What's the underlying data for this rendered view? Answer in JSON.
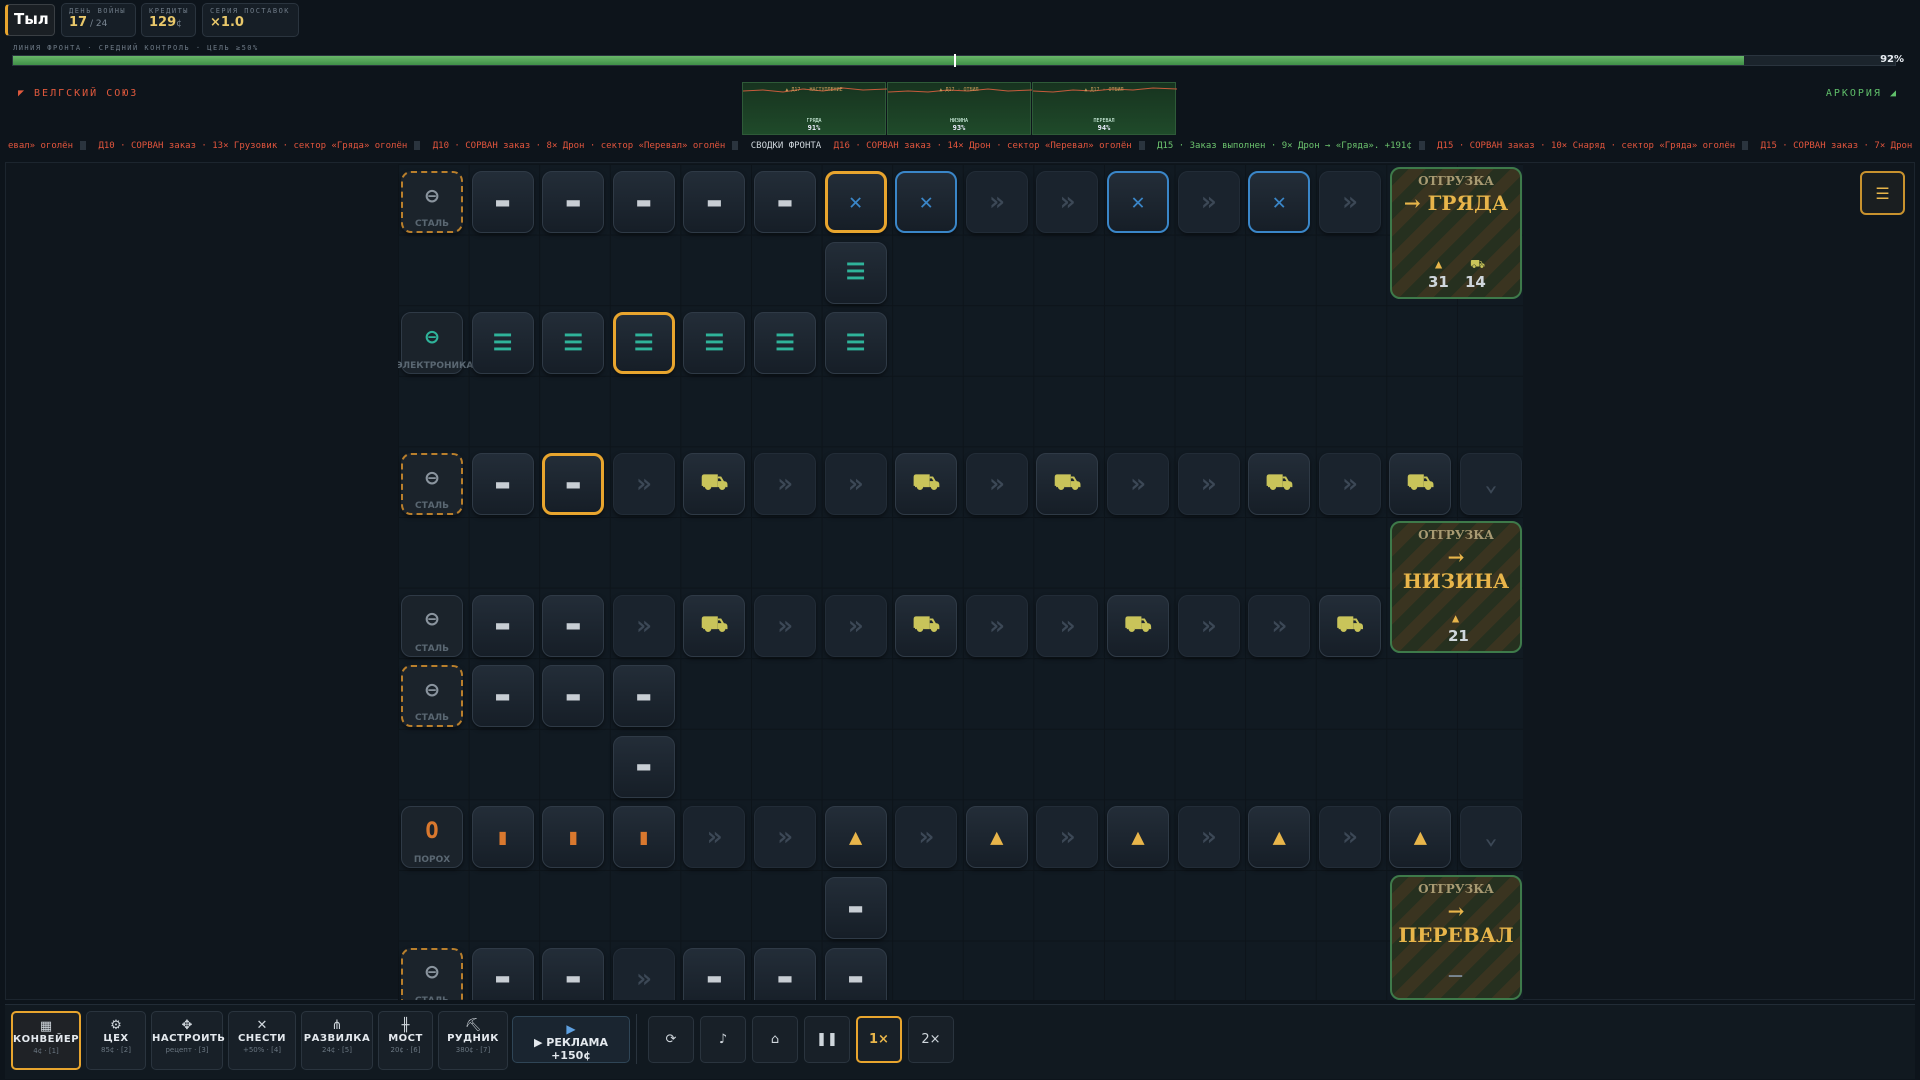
{
  "logo": "Тыл",
  "stats": [
    {
      "label": "ДЕНЬ ВОЙНЫ",
      "value": "17",
      "suffix": "/ 24"
    },
    {
      "label": "КРЕДИТЫ",
      "value": "129",
      "suffix": "¢"
    },
    {
      "label": "СЕРИЯ ПОСТАВОК",
      "value": "×1.0",
      "suffix": ""
    }
  ],
  "front": {
    "label": "ЛИНИЯ ФРОНТА · СРЕДНИЙ КОНТРОЛЬ · ЦЕЛЬ ≥50%",
    "percent": 92,
    "percent_text": "92%",
    "marker": 50
  },
  "factions": {
    "left": "◤ ВЕЛГСКИЙ СОЮЗ",
    "right": "АРКОРИЯ ◢"
  },
  "front_panels": [
    {
      "title": "▲ Д17 · НАСТУПЛЕНИЕ",
      "name": "ГРЯДА",
      "pct": "91%"
    },
    {
      "title": "▲ Д17 · ОТБИЛ",
      "name": "НИЗИНА",
      "pct": "93%"
    },
    {
      "title": "▲ Д17 · ОТБИЛ",
      "name": "ПЕРЕВАЛ",
      "pct": "94%"
    }
  ],
  "ticker": [
    {
      "text": "евал» оголён",
      "tone": "red"
    },
    {
      "text": "Д10 · СОРВАН заказ · 13× Грузовик · сектор «Гряда» оголён",
      "tone": "red"
    },
    {
      "text": "Д10 · СОРВАН заказ · 8× Дрон · сектор «Перевал» оголён",
      "tone": "red"
    },
    {
      "text": "СВОДКИ ФРОНТА",
      "tone": "white"
    },
    {
      "text": "Д16 · СОРВАН заказ · 14× Дрон · сектор «Перевал» оголён",
      "tone": "red"
    },
    {
      "text": "Д15 · Заказ выполнен · 9× Дрон → «Гряда». +191¢",
      "tone": "green"
    },
    {
      "text": "Д15 · СОРВАН заказ · 10× Снаряд · сектор «Гряда» оголён",
      "tone": "red"
    },
    {
      "text": "Д15 · СОРВАН заказ · 7× Дрон ·",
      "tone": "red"
    }
  ],
  "resource_labels": {
    "steel": "СТАЛЬ",
    "electronics": "ЭЛЕКТРОНИКА",
    "powder": "ПОРОХ"
  },
  "shipments": [
    {
      "title": "ОТГРУЗКА",
      "name": "→ ГРЯДА",
      "counts": [
        "31",
        "14"
      ]
    },
    {
      "title": "ОТГРУЗКА",
      "name": "→ НИЗИНА",
      "counts": [
        "21"
      ]
    },
    {
      "title": "ОТГРУЗКА",
      "name": "→ ПЕРЕВАЛ",
      "counts": [
        "—"
      ]
    }
  ],
  "toolbar": [
    {
      "name": "КОНВЕЙЕР",
      "sub": "4¢ · [1]",
      "icon": "conveyor-icon"
    },
    {
      "name": "ЦЕХ",
      "sub": "85¢ · [2]",
      "icon": "gear-icon"
    },
    {
      "name": "НАСТРОИТЬ",
      "sub": "рецепт · [3]",
      "icon": "move-icon"
    },
    {
      "name": "СНЕСТИ",
      "sub": "+50% · [4]",
      "icon": "close-icon"
    },
    {
      "name": "РАЗВИЛКА",
      "sub": "24¢ · [5]",
      "icon": "split-icon"
    },
    {
      "name": "МОСТ",
      "sub": "20¢ · [6]",
      "icon": "bridge-icon"
    },
    {
      "name": "РУДНИК",
      "sub": "380¢ · [7]",
      "icon": "pickaxe-icon"
    }
  ],
  "ad": {
    "label": "▶ РЕКЛАМА +150¢"
  },
  "controls": [
    "⟳",
    "♪",
    "⌂",
    "❚❚",
    "1×",
    "2×"
  ],
  "colors": {
    "accent": "#e8a52e",
    "front_green": "#5fae5f",
    "enemy_red": "#e0593d",
    "electronics": "#2fb39a",
    "powder": "#d9782e",
    "drone": "#3a86c8",
    "truck": "#c9c45a",
    "shell": "#e8b54a"
  }
}
